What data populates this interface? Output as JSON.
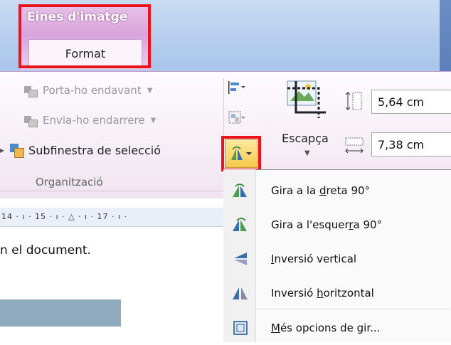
{
  "contextual_tab": {
    "group_title": "Eines d'imatge",
    "tab_label": "Format"
  },
  "arrange_group": {
    "bring_forward": "Porta-ho endavant",
    "send_backward": "Envia-ho endarrere",
    "selection_pane": "Subfinestra de selecció",
    "group_label": "Organització"
  },
  "crop": {
    "label": "Escapça"
  },
  "size": {
    "height": "5,64 cm",
    "width": "7,38 cm"
  },
  "ruler": {
    "text": "14 · ı · 15 · ı ·  △  · ı · 17 · ı ·"
  },
  "document": {
    "text": "n el document."
  },
  "rotate_menu": {
    "items": [
      {
        "pre": "Gira a la ",
        "key": "d",
        "post": "reta 90°"
      },
      {
        "pre": "Gira a l'esquer",
        "key": "r",
        "post": "a 90°"
      },
      {
        "pre": "",
        "key": "I",
        "post": "nversió vertical"
      },
      {
        "pre": "Inversió ",
        "key": "h",
        "post": "oritzontal"
      },
      {
        "pre": "",
        "key": "M",
        "post": "és opcions de gir..."
      }
    ]
  },
  "colors": {
    "highlight": "#e8141c",
    "context_tab": "#d9a4dc",
    "ribbon_blue": "#b9d0ee"
  }
}
